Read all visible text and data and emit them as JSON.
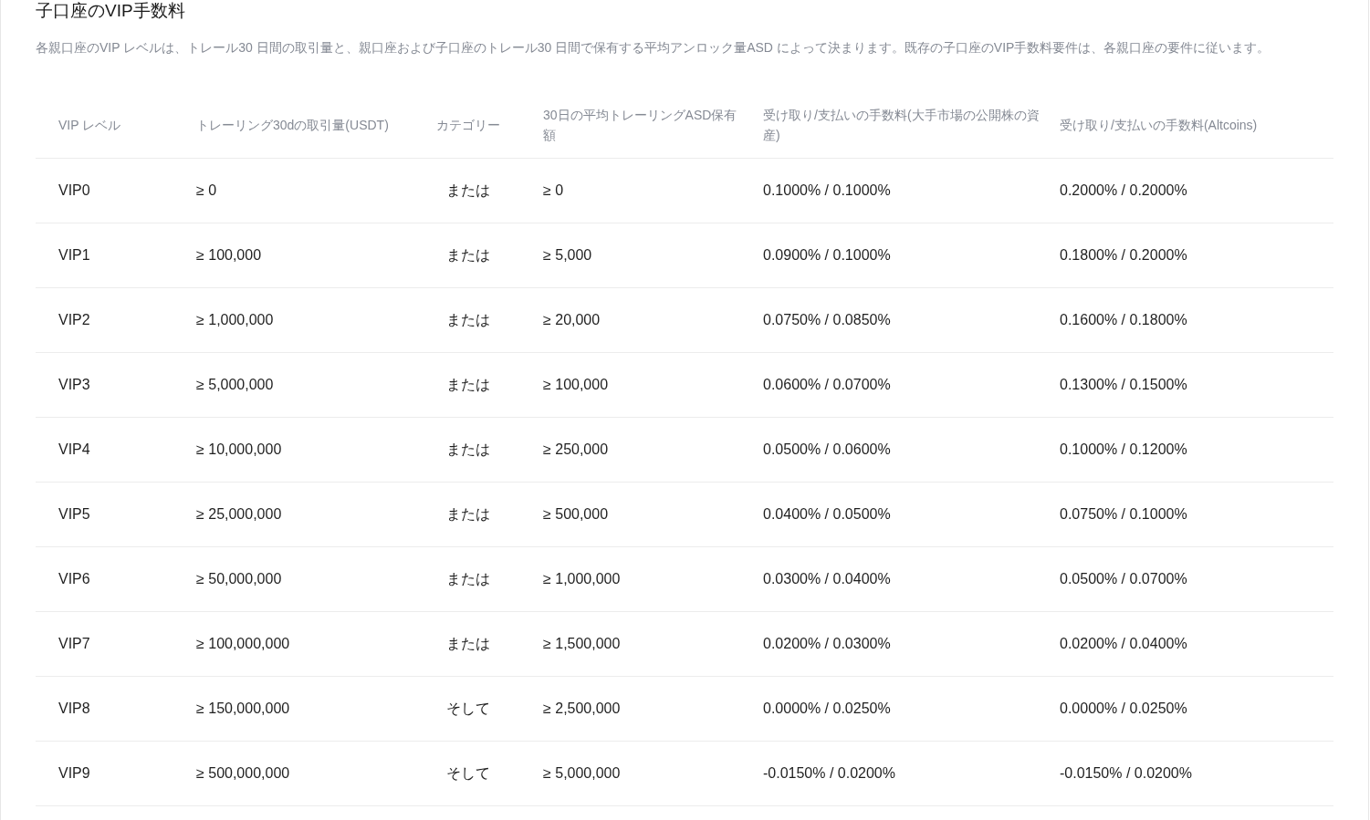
{
  "title": "子口座のVIP手数料",
  "description": "各親口座のVIP レベルは、トレール30 日間の取引量と、親口座および子口座のトレール30 日間で保有する平均アンロック量ASD によって決まります。既存の子口座のVIP手数料要件は、各親口座の要件に従います。",
  "table": {
    "columns": [
      "VIP レベル",
      "トレーリング30dの取引量(USDT)",
      "カテゴリー",
      "30日の平均トレーリングASD保有額",
      "受け取り/支払いの手数料(大手市場の公開株の資産)",
      "受け取り/支払いの手数料(Altcoins)"
    ],
    "rows": [
      [
        "VIP0",
        "≥ 0",
        "または",
        "≥ 0",
        "0.1000% / 0.1000%",
        "0.2000% / 0.2000%"
      ],
      [
        "VIP1",
        "≥ 100,000",
        "または",
        "≥ 5,000",
        "0.0900% / 0.1000%",
        "0.1800% / 0.2000%"
      ],
      [
        "VIP2",
        "≥ 1,000,000",
        "または",
        "≥ 20,000",
        "0.0750% / 0.0850%",
        "0.1600% / 0.1800%"
      ],
      [
        "VIP3",
        "≥ 5,000,000",
        "または",
        "≥ 100,000",
        "0.0600% / 0.0700%",
        "0.1300% / 0.1500%"
      ],
      [
        "VIP4",
        "≥ 10,000,000",
        "または",
        "≥ 250,000",
        "0.0500% / 0.0600%",
        "0.1000% / 0.1200%"
      ],
      [
        "VIP5",
        "≥ 25,000,000",
        "または",
        "≥ 500,000",
        "0.0400% / 0.0500%",
        "0.0750% / 0.1000%"
      ],
      [
        "VIP6",
        "≥ 50,000,000",
        "または",
        "≥ 1,000,000",
        "0.0300% / 0.0400%",
        "0.0500% / 0.0700%"
      ],
      [
        "VIP7",
        "≥ 100,000,000",
        "または",
        "≥ 1,500,000",
        "0.0200% / 0.0300%",
        "0.0200% / 0.0400%"
      ],
      [
        "VIP8",
        "≥ 150,000,000",
        "そして",
        "≥ 2,500,000",
        "0.0000% / 0.0250%",
        "0.0000% / 0.0250%"
      ],
      [
        "VIP9",
        "≥ 500,000,000",
        "そして",
        "≥ 5,000,000",
        "-0.0150% / 0.0200%",
        "-0.0150% / 0.0200%"
      ]
    ]
  }
}
